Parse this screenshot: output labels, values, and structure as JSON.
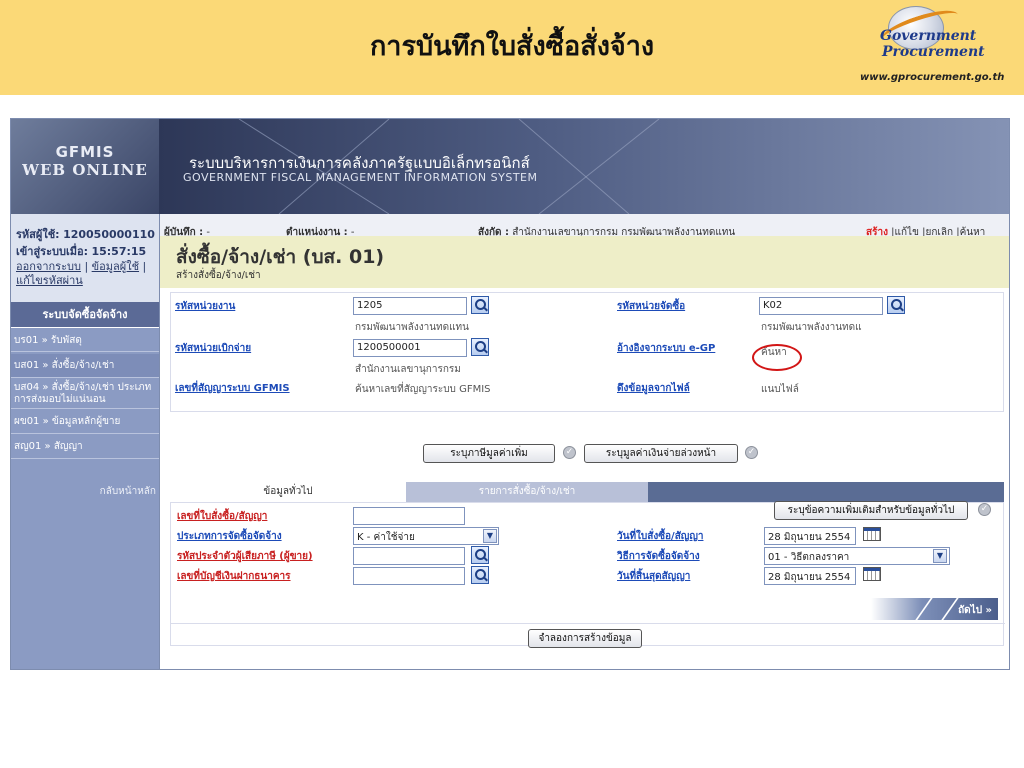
{
  "slide": {
    "title": "การบันทึกใบสั่งซื้อสั่งจ้าง",
    "logo_line1": "Government",
    "logo_line2": "Procurement",
    "logo_url": "www.gprocurement.go.th"
  },
  "app": {
    "logo_top": "GFMIS",
    "logo_bottom": "WEB ONLINE",
    "system_name_th": "ระบบบริหารการเงินการคลังภาครัฐแบบอิเล็กทรอนิกส์",
    "system_name_en": "GOVERNMENT FISCAL MANAGEMENT INFORMATION SYSTEM"
  },
  "sidebar": {
    "user_label": "รหัสผู้ใช้:",
    "user_id": "120050000110",
    "login_label": "เข้าสู่ระบบเมื่อ:",
    "login_time": "15:57:15",
    "logout_link": "ออกจากระบบ",
    "profile_link": "ข้อมูลผู้ใช้",
    "change_pw_link": "แก้ไขรหัสผ่าน",
    "menu_header": "ระบบจัดซื้อจัดจ้าง",
    "items": [
      {
        "label": "บร01 » รับพัสดุ"
      },
      {
        "label": "บส01 » สั่งซื้อ/จ้าง/เช่า"
      },
      {
        "label": "บส04 » สั่งซื้อ/จ้าง/เช่า ประเภทการส่งมอบไม่แน่นอน"
      },
      {
        "label": "ผข01 » ข้อมูลหลักผู้ขาย"
      },
      {
        "label": "สญ01 » สัญญา"
      }
    ],
    "back_link": "กลับหน้าหลัก"
  },
  "infobar": {
    "recorder_label": "ผู้บันทึก :",
    "recorder_value": "-",
    "position_label": "ตำแหน่งงาน :",
    "position_value": "-",
    "affiliation_label": "สังกัด :",
    "affiliation_value": "สำนักงานเลขานุการกรม กรมพัฒนาพลังงานทดแทน",
    "action_create": "สร้าง",
    "action_edit": "แก้ไข",
    "action_cancel": "ยกเลิก",
    "action_search": "ค้นหา"
  },
  "page": {
    "title": "สั่งซื้อ/จ้าง/เช่า (บส. 01)",
    "subtitle": "สร้างสั่งซื้อ/จ้าง/เช่า"
  },
  "form1": {
    "unit_code_label": "รหัสหน่วยงาน",
    "unit_code_value": "1205",
    "unit_name": "กรมพัฒนาพลังงานทดแทน",
    "disburse_label": "รหัสหน่วยเบิกจ่าย",
    "disburse_value": "1200500001",
    "disburse_name": "สำนักงานเลขานุการกรม",
    "contract_label": "เลขที่สัญญาระบบ GFMIS",
    "contract_hint": "ค้นหาเลขที่สัญญาระบบ GFMIS",
    "purch_unit_label": "รหัสหน่วยจัดซื้อ",
    "purch_unit_value": "K02",
    "purch_unit_name": "กรมพัฒนาพลังงานทดแ",
    "egp_label": "อ้างอิงจากระบบ e-GP",
    "egp_value": "ค้นหา",
    "file_label": "ดึงข้อมูลจากไฟล์",
    "file_value": "แนบไฟล์",
    "btn_vat": "ระบุภาษีมูลค่าเพิ่ม",
    "btn_advance": "ระบุมูลค่าเงินจ่ายล่วงหน้า"
  },
  "tabs": {
    "general": "ข้อมูลทั่วไป",
    "items": "รายการสั่งซื้อ/จ้าง/เช่า"
  },
  "form2": {
    "po_label": "เลขที่ใบสั่งซื้อ/สัญญา",
    "po_value": "",
    "type_label": "ประเภทการจัดซื้อจัดจ้าง",
    "type_value": "K - ค่าใช้จ่าย",
    "tax_label": "รหัสประจำตัวผู้เสียภาษี (ผู้ขาย)",
    "tax_value": "",
    "bank_label": "เลขที่บัญชีเงินฝากธนาคาร",
    "bank_value": "",
    "btn_more_info": "ระบุข้อความเพิ่มเติมสำหรับข้อมูลทั่วไป",
    "po_date_label": "วันที่ใบสั่งซื้อ/สัญญา",
    "po_date_value": "28 มิถุนายน 2554",
    "method_label": "วิธีการจัดซื้อจัดจ้าง",
    "method_value": "01 - วิธีตกลงราคา",
    "end_date_label": "วันที่สิ้นสุดสัญญา",
    "end_date_value": "28 มิถุนายน 2554",
    "next_label": "ถัดไป »",
    "btn_simulate": "จำลองการสร้างข้อมูล"
  }
}
